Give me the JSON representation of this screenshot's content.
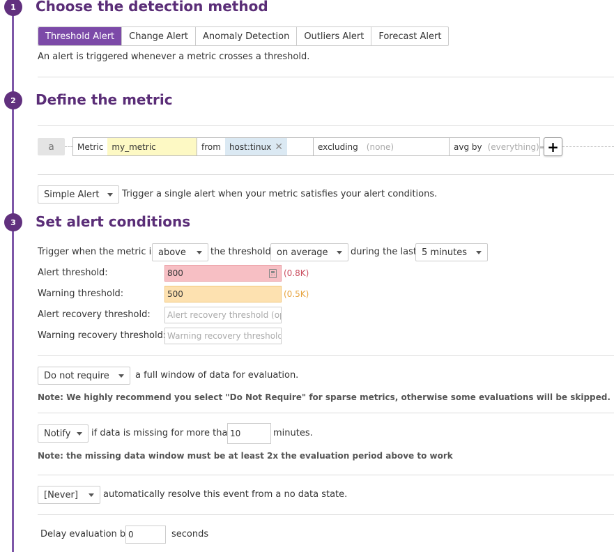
{
  "colors": {
    "timeline": "#7e57a8",
    "step_badge": "#61307e",
    "active_tab": "#7c4aa8",
    "alert_bg": "#f7bfc4",
    "warning_bg": "#fde1b0",
    "alert_text": "#c94b5d",
    "warning_text": "#e6a23c"
  },
  "step1": {
    "number": "1",
    "title": "Choose the detection method",
    "tabs": [
      "Threshold Alert",
      "Change Alert",
      "Anomaly Detection",
      "Outliers Alert",
      "Forecast Alert"
    ],
    "active_tab": "Threshold Alert",
    "description": "An alert is triggered whenever a metric crosses a threshold."
  },
  "step2": {
    "number": "2",
    "title": "Define the metric",
    "query": {
      "badge": "a",
      "metric_label": "Metric",
      "metric_value": "my_metric",
      "from_label": "from",
      "from_tag": "host:tinux",
      "excluding_label": "excluding",
      "excluding_placeholder": "(none)",
      "avg_by_label": "avg by",
      "avg_by_placeholder": "(everything)",
      "add_icon": "plus-icon"
    },
    "alert_type": {
      "selected": "Simple Alert",
      "description": "Trigger a single alert when your metric satisfies your alert conditions."
    }
  },
  "step3": {
    "number": "3",
    "title": "Set alert conditions",
    "trigger": {
      "prefix": "Trigger when the metric is",
      "comparison": "above",
      "mid_text": "the threshold",
      "aggregation": "on average",
      "during_text": "during the last",
      "window": "5 minutes"
    },
    "thresholds": {
      "alert_label": "Alert threshold:",
      "alert_value": "800",
      "alert_hint": "(0.8K)",
      "warning_label": "Warning threshold:",
      "warning_value": "500",
      "warning_hint": "(0.5K)",
      "alert_recovery_label": "Alert recovery threshold:",
      "alert_recovery_placeholder": "Alert recovery threshold (opt",
      "warning_recovery_label": "Warning recovery threshold:",
      "warning_recovery_placeholder": "Warning recovery threshold"
    },
    "full_window": {
      "selected": "Do not require",
      "text": "a full window of data for evaluation.",
      "note": "Note: We highly recommend you select \"Do Not Require\" for sparse metrics, otherwise some evaluations will be skipped."
    },
    "missing_data": {
      "selected": "Notify",
      "text_before": "if data is missing for more than",
      "minutes_value": "10",
      "text_after": "minutes.",
      "note": "Note: the missing data window must be at least 2x the evaluation period above to work"
    },
    "auto_resolve": {
      "selected": "[Never]",
      "text": "automatically resolve this event from a no data state."
    },
    "delay": {
      "label": "Delay evaluation by",
      "value": "0",
      "unit": "seconds"
    }
  }
}
